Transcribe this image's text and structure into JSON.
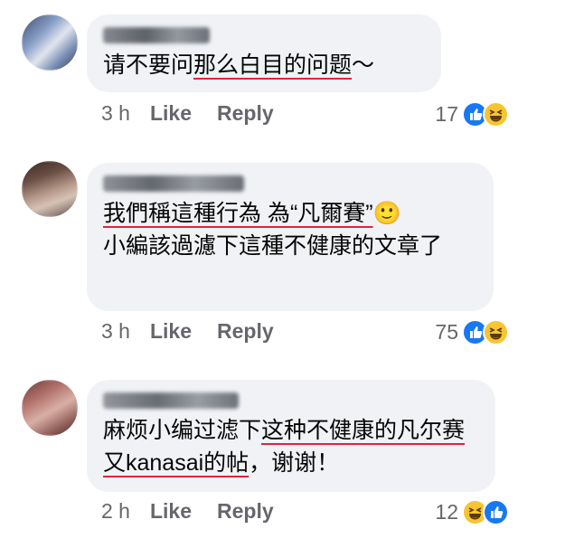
{
  "comments": [
    {
      "text_parts": [
        {
          "t": "请不要问",
          "u": false
        },
        {
          "t": "那么白目的问题",
          "u": true
        },
        {
          "t": "～",
          "u": false
        }
      ],
      "time": "3 h",
      "like_label": "Like",
      "reply_label": "Reply",
      "reaction_count": "17",
      "reactions": [
        "like-icon",
        "haha-icon"
      ]
    },
    {
      "text_parts": [
        {
          "t": "我們稱這種行為 為“凡爾賽”",
          "u": true
        },
        {
          "t": "🙂",
          "u": false
        },
        {
          "t": "小編該過濾下這種不健康的文章了",
          "u": false
        }
      ],
      "time": "3 h",
      "like_label": "Like",
      "reply_label": "Reply",
      "reaction_count": "75",
      "reactions": [
        "like-icon",
        "haha-icon"
      ]
    },
    {
      "text_parts": [
        {
          "t": "麻烦小编过滤下",
          "u": false
        },
        {
          "t": "这种不健康的凡尔赛又kanasai的帖",
          "u": true
        },
        {
          "t": "，谢谢！",
          "u": false
        }
      ],
      "time": "2 h",
      "like_label": "Like",
      "reply_label": "Reply",
      "reaction_count": "12",
      "reactions": [
        "haha-icon",
        "like-icon"
      ]
    }
  ]
}
